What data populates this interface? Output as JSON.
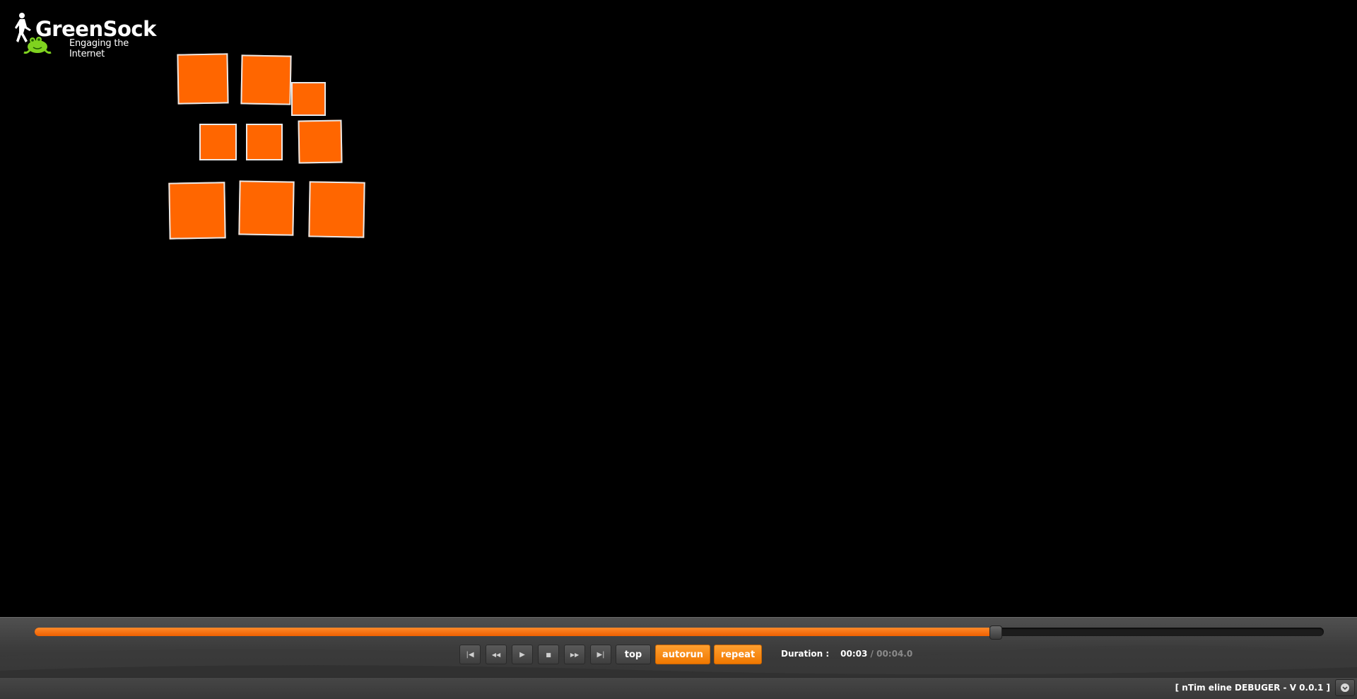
{
  "logo": {
    "title": "GreenSock",
    "tagline": "Engaging the Internet",
    "icon": "greensock-walker-frog-logo"
  },
  "stage": {
    "background": "#000000",
    "box_color": "#ff6600",
    "box_border_color": "#e8e8e8"
  },
  "timeline": {
    "progress": 0.745,
    "fill_color": "#ff6600"
  },
  "controls": {
    "first_icon": "skip-to-start-icon",
    "first_glyph": "|◀",
    "rewind_icon": "rewind-icon",
    "rewind_glyph": "◀◀",
    "play_icon": "play-icon",
    "play_glyph": "▶",
    "stop_icon": "stop-icon",
    "stop_glyph": "■",
    "forward_icon": "fast-forward-icon",
    "forward_glyph": "▶▶",
    "last_icon": "skip-to-end-icon",
    "last_glyph": "▶|",
    "top_label": "top",
    "autorun_label": "autorun",
    "repeat_label": "repeat",
    "accent_color": "#f08c00"
  },
  "duration": {
    "label": "Duration :",
    "current": "00:03",
    "separator": " / ",
    "total": "00:04.0"
  },
  "status": {
    "label": "[ nTim eline DEBUGER - V 0.0.1 ]",
    "toggle_icon": "chevron-down-circle-icon"
  }
}
